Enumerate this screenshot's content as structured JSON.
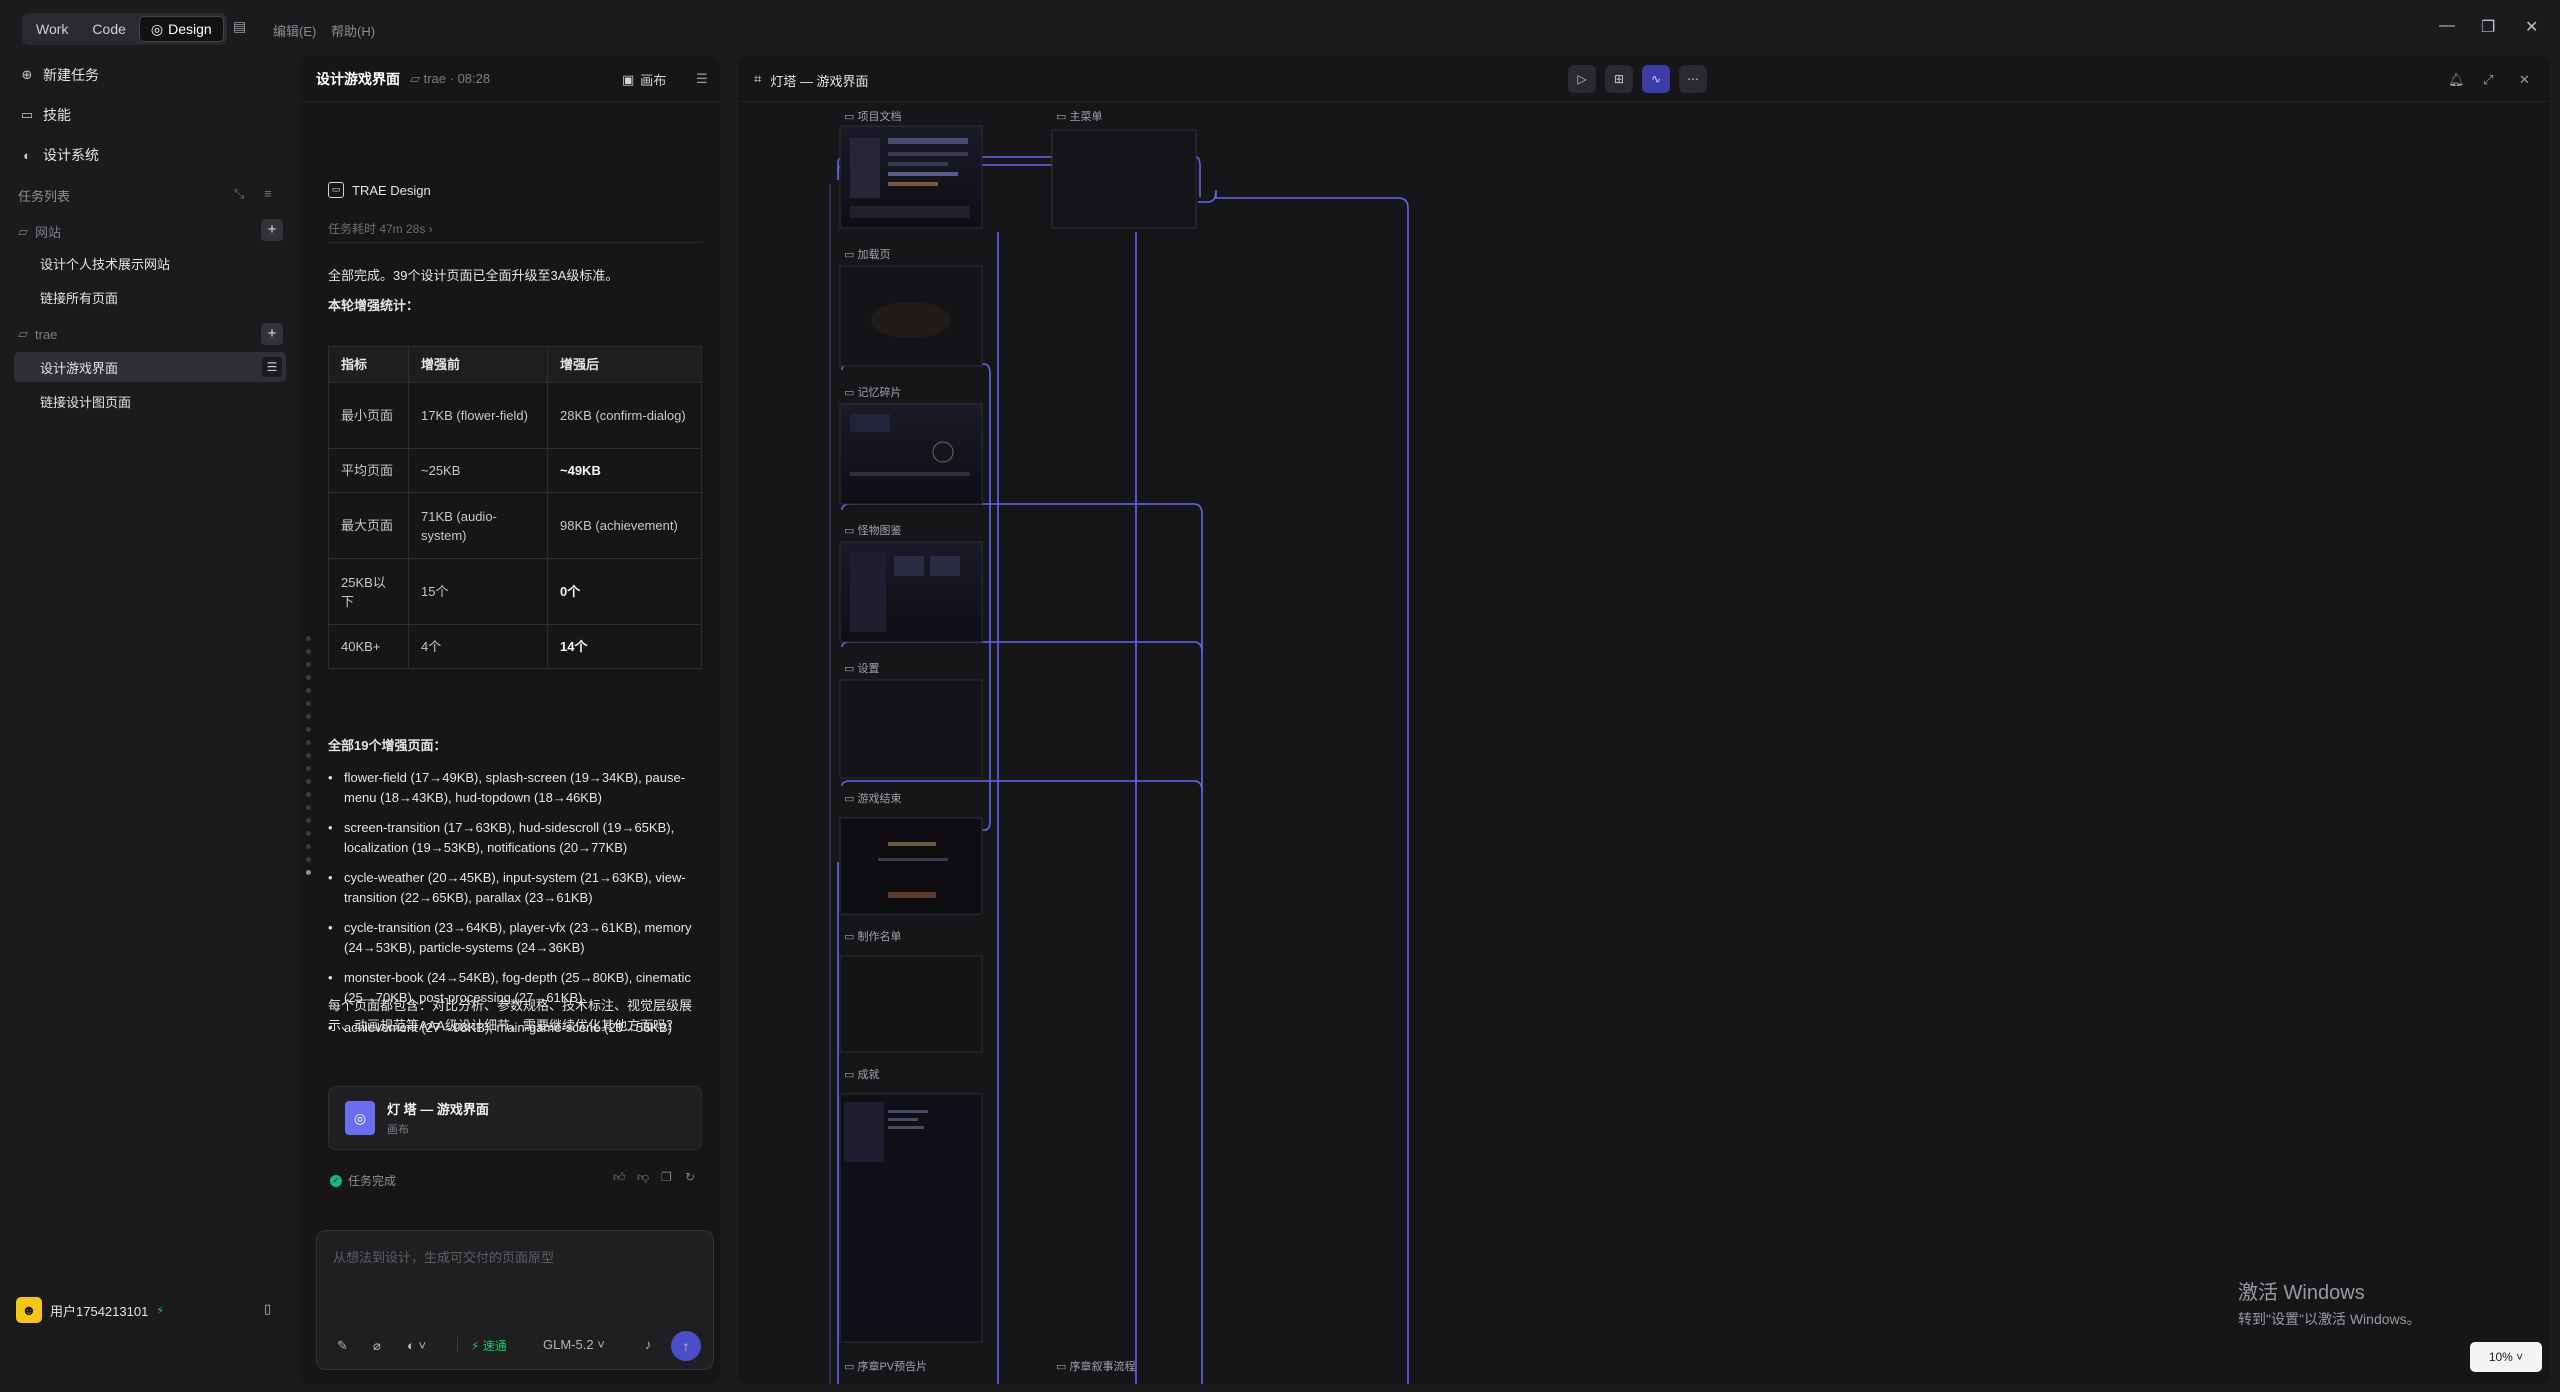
{
  "topbar": {
    "mode_tabs": [
      {
        "label": "Work"
      },
      {
        "label": "Code"
      },
      {
        "label": "Design"
      }
    ],
    "menus": [
      "编辑(E)",
      "帮助(H)"
    ]
  },
  "sidebar": {
    "nav": [
      {
        "label": "新建任务",
        "icon": "plus-circle-icon"
      },
      {
        "label": "技能",
        "icon": "book-icon"
      },
      {
        "label": "设计系统",
        "icon": "palette-icon"
      }
    ],
    "task_list_label": "任务列表",
    "groups": [
      {
        "name": "网站",
        "tasks": [
          "设计个人技术展示网站",
          "链接所有页面"
        ]
      },
      {
        "name": "trae",
        "tasks": [
          "设计游戏界面",
          "链接设计图页面"
        ]
      }
    ],
    "user": {
      "name": "用户1754213101"
    }
  },
  "chat": {
    "header": {
      "title": "设计游戏界面",
      "project": "trae · 08:28",
      "canvas_label": "画布"
    },
    "agent_name": "TRAE Design",
    "elapsed": "任务耗时 47m 28s",
    "summary": "全部完成。39个设计页面已全面升级至3A级标准。",
    "stats_title": "本轮增强统计：",
    "table": {
      "headers": [
        "指标",
        "增强前",
        "增强后"
      ],
      "rows": [
        [
          "最小页面",
          "17KB (flower-field)",
          "28KB (confirm-dialog)"
        ],
        [
          "平均页面",
          "~25KB",
          "~49KB"
        ],
        [
          "最大页面",
          "71KB (audio-system)",
          "98KB (achievement)"
        ],
        [
          "25KB以下",
          "15个",
          "0个"
        ],
        [
          "40KB+",
          "4个",
          "14个"
        ]
      ]
    },
    "pages_title": "全部19个增强页面：",
    "pages": [
      "flower-field (17→49KB), splash-screen (19→34KB), pause-menu (18→43KB), hud-topdown (18→46KB)",
      "screen-transition (17→63KB), hud-sidescroll (19→65KB), localization (19→53KB), notifications (20→77KB)",
      "cycle-weather (20→45KB), input-system (21→63KB), view-transition (22→65KB), parallax (23→61KB)",
      "cycle-transition (23→64KB), player-vfx (23→61KB), memory (24→53KB), particle-systems (24→36KB)",
      "monster-book (24→54KB), fog-depth (25→80KB), cinematic (25→70KB), post-processing (27→61KB)",
      "achievement (27→98KB), main-game-scene (28→56KB)"
    ],
    "closing": "每个页面都包含：对比分析、参数规格、技术标注、视觉层级展示、动画规范等AAA级设计细节。需要继续优化其他方面吗？",
    "artifact": {
      "title": "灯 塔 — 游戏界面",
      "subtitle": "画布"
    },
    "status": "任务完成",
    "composer": {
      "placeholder": "从想法到设计，生成可交付的页面原型",
      "fast_label": "速通",
      "model": "GLM-5.2"
    }
  },
  "canvas": {
    "title": "灯塔 — 游戏界面",
    "frames": [
      "项目文档",
      "主菜单",
      "加载页",
      "记忆碎片",
      "怪物图鉴",
      "设置",
      "游戏结束",
      "制作名单",
      "成就",
      "序章PV预告片",
      "序章叙事流程"
    ],
    "zoom": "10%",
    "accent": "#6366f1"
  },
  "watermark": {
    "line1": "激活 Windows",
    "line2": "转到\"设置\"以激活 Windows。"
  }
}
